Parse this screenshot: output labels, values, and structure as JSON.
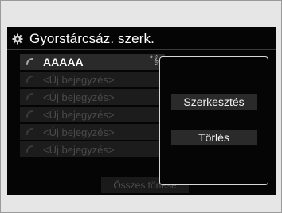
{
  "header": {
    "title": "Gyorstárcsáz. szerk.",
    "icon": "gear-icon"
  },
  "list": {
    "entries": [
      {
        "label": "AAAAA",
        "selected": true,
        "voice_tag": "✓"
      },
      {
        "label": "<Új bejegyzés>",
        "selected": false
      },
      {
        "label": "<Új bejegyzés>",
        "selected": false
      },
      {
        "label": "<Új bejegyzés>",
        "selected": false
      },
      {
        "label": "<Új bejegyzés>",
        "selected": false
      },
      {
        "label": "<Új bejegyzés>",
        "selected": false
      }
    ]
  },
  "popup": {
    "edit_label": "Szerkesztés",
    "delete_label": "Törlés"
  },
  "footer": {
    "delete_all_label": "Összes törlése"
  },
  "colors": {
    "screen_bg": "#050505",
    "text_active": "#ffffff",
    "text_disabled": "#4a4a4a",
    "popup_border": "#d8d8d8"
  }
}
